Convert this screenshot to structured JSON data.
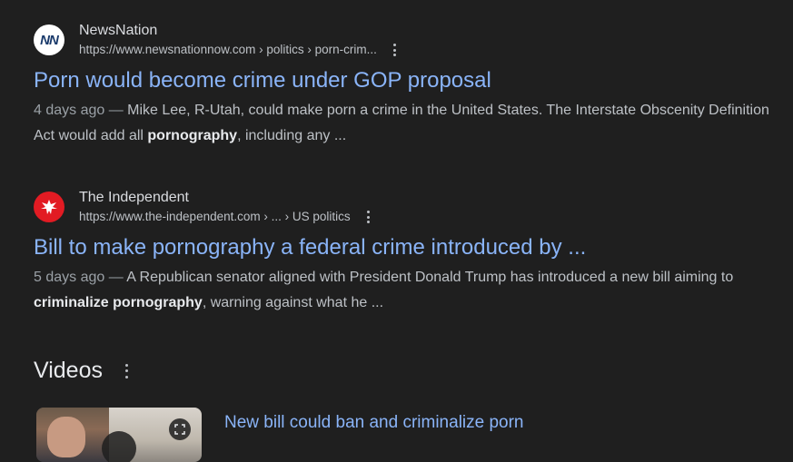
{
  "results": [
    {
      "site_name": "NewsNation",
      "favicon_text": "NN",
      "favicon_icon": "newsnation-logo-icon",
      "url": "https://www.newsnationnow.com › politics › porn-crim...",
      "title": "Porn would become crime under GOP proposal",
      "snippet": {
        "date": "4 days ago",
        "separator": " — ",
        "before": "Mike Lee, R-Utah, could make porn a crime in the United States. The Interstate Obscenity Definition Act would add all ",
        "bold": "pornography",
        "after": ", including any ..."
      }
    },
    {
      "site_name": "The Independent",
      "favicon_icon": "independent-eagle-icon",
      "url": "https://www.the-independent.com › ... › US politics",
      "title": "Bill to make pornography a federal crime introduced by ...",
      "snippet": {
        "date": "5 days ago",
        "separator": " — ",
        "before": "A Republican senator aligned with President Donald Trump has introduced a new bill aiming to ",
        "bold": "criminalize pornography",
        "after": ", warning against what he ..."
      }
    }
  ],
  "videos": {
    "heading": "Videos",
    "items": [
      {
        "title": "New bill could ban and criminalize porn"
      }
    ]
  },
  "colors": {
    "background": "#1f1f1f",
    "link": "#8ab4f8",
    "text": "#bdc1c6",
    "independent_red": "#e21b23"
  }
}
